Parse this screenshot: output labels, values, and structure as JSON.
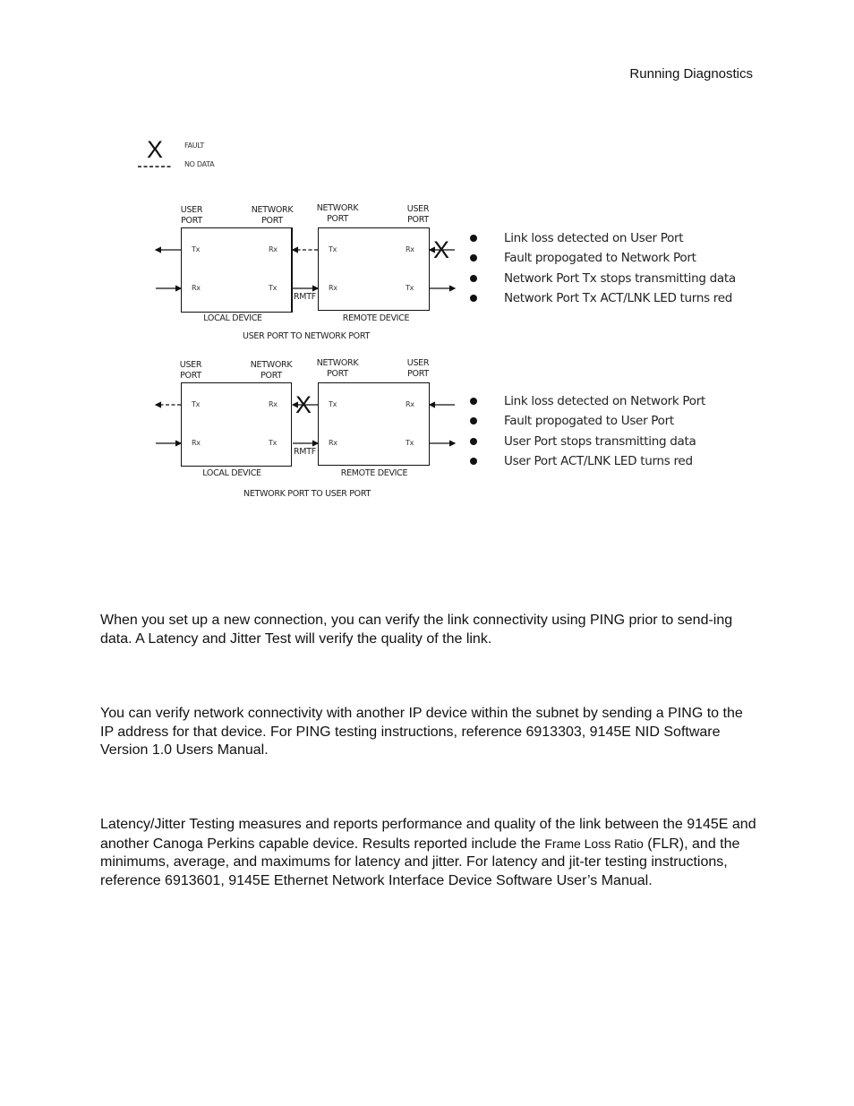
{
  "header": {
    "title": "Running Diagnostics"
  },
  "legend": {
    "fault_symbol": "X",
    "fault_label": "FAULT",
    "no_data_label": "NO DATA"
  },
  "diagrams": [
    {
      "caption": "USER PORT TO NETWORK PORT",
      "local": {
        "label": "LOCAL DEVICE",
        "left_port": [
          "USER",
          "PORT"
        ],
        "right_port": [
          "NETWORK",
          "PORT"
        ],
        "left_top": "Tx",
        "left_bottom": "Rx",
        "right_top": "Rx",
        "right_bottom": "Tx"
      },
      "remote": {
        "label": "REMOTE DEVICE",
        "left_port": [
          "NETWORK",
          "PORT"
        ],
        "right_port": [
          "USER",
          "PORT"
        ],
        "left_top": "Tx",
        "left_bottom": "Rx",
        "right_top": "Rx",
        "right_bottom": "Tx"
      },
      "rmtf_label": "RMTF",
      "fault_symbol": "X",
      "fault_location": "remote user port Rx",
      "bullets": [
        "Link loss detected on User Port",
        "Fault propogated to Network Port",
        "Network Port Tx stops transmitting data",
        "Network Port Tx  ACT/LNK LED turns red"
      ]
    },
    {
      "caption": "NETWORK PORT TO USER PORT",
      "local": {
        "label": "LOCAL DEVICE",
        "left_port": [
          "USER",
          "PORT"
        ],
        "right_port": [
          "NETWORK",
          "PORT"
        ],
        "left_top": "Tx",
        "left_bottom": "Rx",
        "right_top": "Rx",
        "right_bottom": "Tx"
      },
      "remote": {
        "label": "REMOTE DEVICE",
        "left_port": [
          "NETWORK",
          "PORT"
        ],
        "right_port": [
          "USER",
          "PORT"
        ],
        "left_top": "Tx",
        "left_bottom": "Rx",
        "right_top": "Rx",
        "right_bottom": "Tx"
      },
      "rmtf_label": "RMTF",
      "fault_symbol": "X",
      "fault_location": "local network port Rx",
      "bullets": [
        "Link loss detected on Network Port",
        "Fault propogated to User Port",
        "User Port stops transmitting data",
        "User Port ACT/LNK LED turns red"
      ]
    }
  ],
  "paragraphs": {
    "intro": "When you set up a new connection, you can verify the link connectivity using PING prior to send-ing data. A Latency and Jitter Test will verify the quality of the link.",
    "ping": "You can verify network connectivity with another IP device within the subnet by sending a PING to the IP address for that device. For PING testing instructions, reference 6913303, 9145E NID Software Version 1.0 Users Manual.",
    "latency_before": "Latency/Jitter Testing measures and reports performance and quality of the link between the 9145E and another Canoga Perkins capable device. Results reported include the ",
    "latency_small": "Frame Loss Ratio",
    "latency_after": " (FLR), and the minimums, average, and maximums for latency and jitter. For latency and jit-ter testing instructions, reference 6913601, 9145E Ethernet Network Interface Device Software User’s Manual."
  }
}
